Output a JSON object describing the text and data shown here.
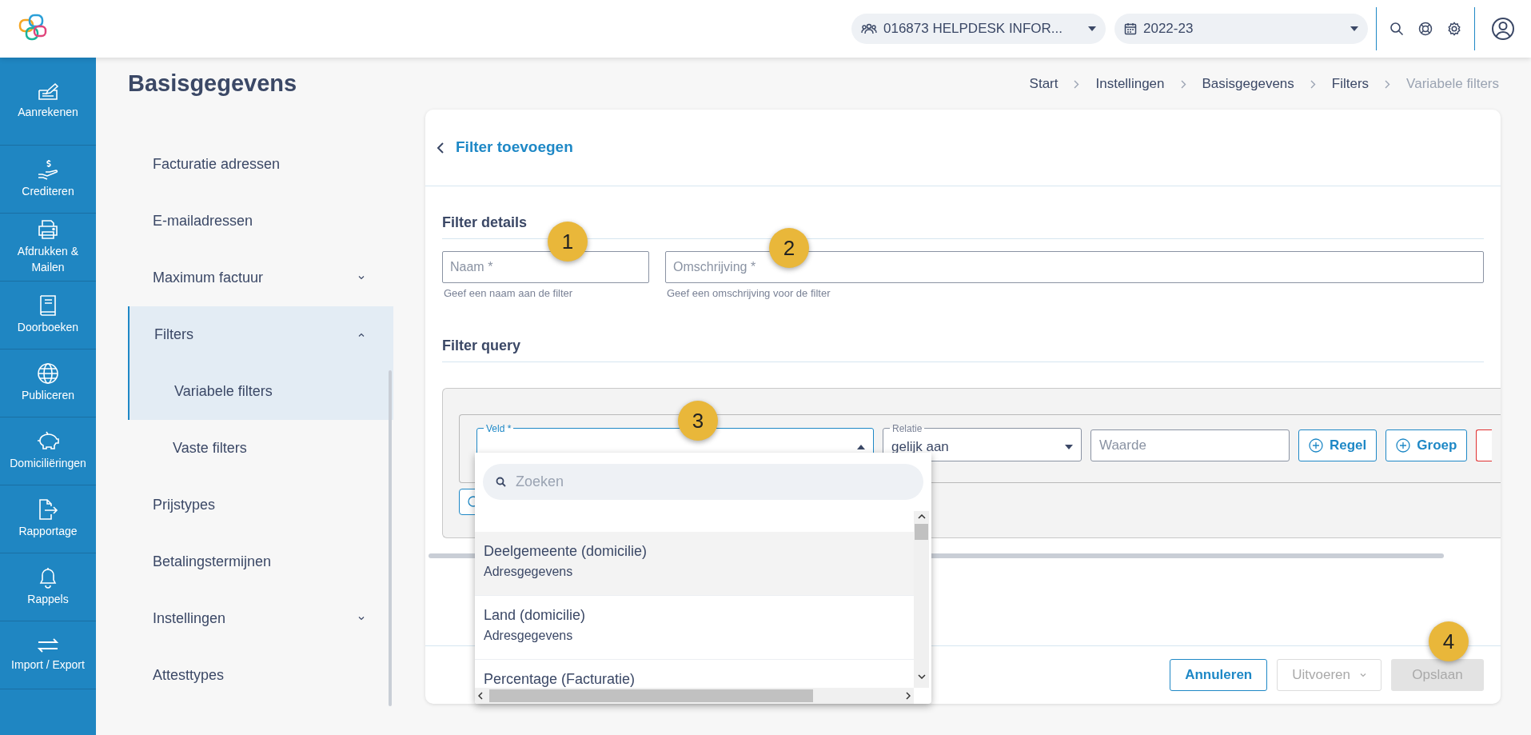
{
  "header": {
    "client_select": {
      "value": "016873 HELPDESK INFOR..."
    },
    "year_select": {
      "value": "2022-23"
    }
  },
  "nav": [
    {
      "label": "Aanrekenen"
    },
    {
      "label": "Crediteren"
    },
    {
      "label": "Afdrukken & Mailen"
    },
    {
      "label": "Doorboeken"
    },
    {
      "label": "Publiceren"
    },
    {
      "label": "Domiciliëringen"
    },
    {
      "label": "Rapportage"
    },
    {
      "label": "Rappels"
    },
    {
      "label": "Import / Export"
    }
  ],
  "page_title": "Basisgegevens",
  "breadcrumb": [
    {
      "label": "Start",
      "current": false
    },
    {
      "label": "Instellingen",
      "current": false
    },
    {
      "label": "Basisgegevens",
      "current": false
    },
    {
      "label": "Filters",
      "current": false
    },
    {
      "label": "Variabele filters",
      "current": true
    }
  ],
  "submenu": [
    {
      "label": "Facturatie adressen",
      "selected": false
    },
    {
      "label": "E-mailadressen",
      "selected": false
    },
    {
      "label": "Maximum factuur",
      "selected": false,
      "expanded": false
    },
    {
      "label": "Filters",
      "selected": true,
      "expanded": true,
      "children": [
        {
          "label": "Variabele filters",
          "selected": true
        },
        {
          "label": "Vaste filters",
          "selected": false
        }
      ]
    },
    {
      "label": "Prijstypes",
      "selected": false
    },
    {
      "label": "Betalingstermijnen",
      "selected": false
    },
    {
      "label": "Instellingen",
      "selected": false,
      "expanded": false
    },
    {
      "label": "Attesttypes",
      "selected": false
    }
  ],
  "form": {
    "title": "Filter toevoegen",
    "details_heading": "Filter details",
    "fields": [
      {
        "placeholder": "Naam *",
        "helper": "Geef een naam aan de filter"
      },
      {
        "placeholder": "Omschrijving *",
        "helper": "Geef een omschrijving voor de filter"
      }
    ],
    "query_heading": "Filter query",
    "query": {
      "field": {
        "label": "Veld *",
        "focused": true
      },
      "relation": {
        "label": "Relatie",
        "value": "gelijk aan"
      },
      "value": {
        "placeholder": "Waarde"
      },
      "buttons": [
        "Regel",
        "Groep"
      ]
    },
    "dropdown": {
      "search_placeholder": "Zoeken",
      "options": [
        {
          "title": "Deelgemeente (domicilie)",
          "subtitle": "Adresgegevens",
          "highlighted": true
        },
        {
          "title": "Land (domicilie)",
          "subtitle": "Adresgegevens",
          "highlighted": false
        },
        {
          "title": "Percentage (Facturatie)",
          "highlighted": false
        }
      ]
    },
    "footer_buttons": [
      {
        "label": "Annuleren",
        "disabled": false,
        "dropdown": false
      },
      {
        "label": "Uitvoeren",
        "disabled": true,
        "dropdown": true
      },
      {
        "label": "Opslaan",
        "disabled": true,
        "dropdown": false
      }
    ]
  },
  "annotations": [
    "1",
    "2",
    "3",
    "4"
  ]
}
